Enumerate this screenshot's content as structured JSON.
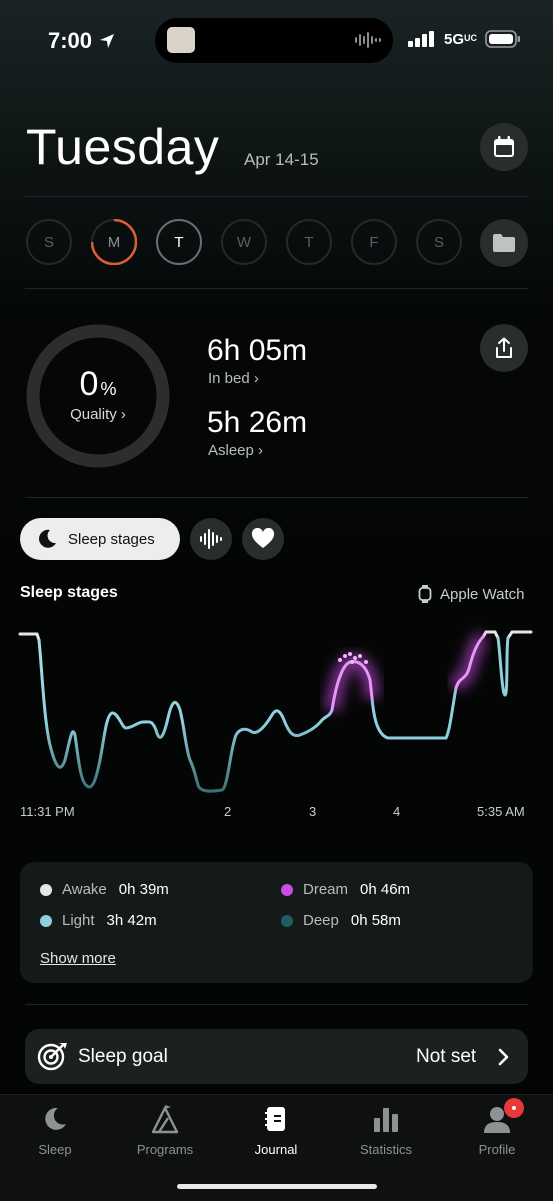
{
  "status_bar": {
    "time": "7:00",
    "network": "5G",
    "network_sub": "UC"
  },
  "header": {
    "title": "Tuesday",
    "date_range": "Apr 14-15"
  },
  "days": [
    {
      "label": "S"
    },
    {
      "label": "M"
    },
    {
      "label": "T"
    },
    {
      "label": "W"
    },
    {
      "label": "T"
    },
    {
      "label": "F"
    },
    {
      "label": "S"
    }
  ],
  "summary": {
    "quality_value": "0",
    "quality_unit": "%",
    "quality_label": "Quality",
    "in_bed_value": "6h 05m",
    "in_bed_label": "In bed",
    "asleep_value": "5h 26m",
    "asleep_label": "Asleep"
  },
  "chips": {
    "sleep_stages_label": "Sleep stages"
  },
  "chart_data": {
    "type": "line",
    "title": "Sleep stages",
    "source": "Apple Watch",
    "x_tick_labels": [
      "11:31 PM",
      "2",
      "3",
      "4",
      "5:35 AM"
    ],
    "stages": [
      "Awake",
      "Dream",
      "Light",
      "Deep"
    ]
  },
  "legend": [
    {
      "name": "Awake",
      "value": "0h 39m",
      "color": "#e6e6e6"
    },
    {
      "name": "Dream",
      "value": "0h 46m",
      "color": "#c94fe0"
    },
    {
      "name": "Light",
      "value": "3h 42m",
      "color": "#8ed0dd"
    },
    {
      "name": "Deep",
      "value": "0h 58m",
      "color": "#1f5d62"
    }
  ],
  "show_more": "Show more",
  "goal": {
    "label": "Sleep goal",
    "value": "Not set"
  },
  "tabs": [
    {
      "label": "Sleep",
      "icon": "moon-icon"
    },
    {
      "label": "Programs",
      "icon": "programs-icon"
    },
    {
      "label": "Journal",
      "icon": "journal-icon"
    },
    {
      "label": "Statistics",
      "icon": "bar-chart-icon"
    },
    {
      "label": "Profile",
      "icon": "person-icon"
    }
  ]
}
